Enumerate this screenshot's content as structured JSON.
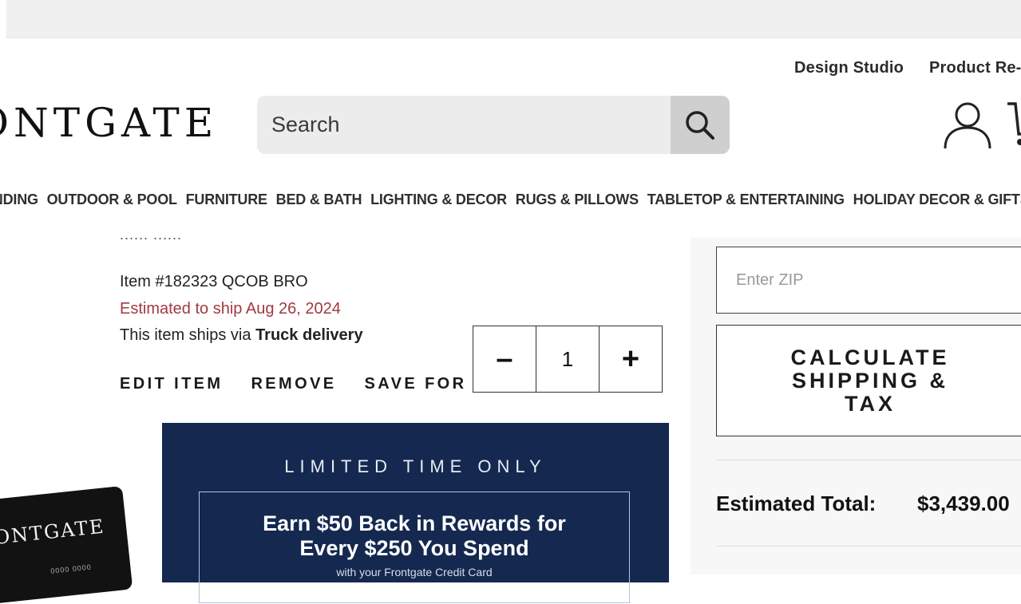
{
  "header": {
    "utility_links": [
      "Design Studio",
      "Product Re-"
    ],
    "logo_text": "ONTGATE",
    "search": {
      "placeholder": "Search"
    }
  },
  "nav": {
    "items": [
      "INDING",
      "OUTDOOR & POOL",
      "FURNITURE",
      "BED & BATH",
      "LIGHTING & DECOR",
      "RUGS & PILLOWS",
      "TABLETOP & ENTERTAINING",
      "HOLIDAY DECOR & GIFTS",
      ":"
    ]
  },
  "cart_item": {
    "cut_off_text": "......  ......",
    "item_number": "Item #182323 QCOB BRO",
    "estimated_ship": "Estimated to ship Aug 26, 2024",
    "ships_via_prefix": "This item ships via ",
    "ships_via_method": "Truck delivery",
    "actions": [
      "EDIT ITEM",
      "REMOVE",
      "SAVE FOR LATER"
    ],
    "quantity": {
      "minus": "–",
      "value": "1",
      "plus": "+"
    }
  },
  "promo": {
    "kicker": "LIMITED TIME ONLY",
    "headline_line1": "Earn $50 Back in Rewards for",
    "headline_line2": "Every $250 You Spend",
    "subtext": "with your Frontgate Credit Card",
    "card_logo": "ONTGATE",
    "card_small_text": "0000 0000"
  },
  "summary": {
    "zip_placeholder": "Enter ZIP",
    "calculate_button": "CALCULATE SHIPPING & TAX",
    "estimated_total_label": "Estimated Total:",
    "estimated_total_value": "$3,439.00"
  },
  "colors": {
    "promo_bg": "#142850",
    "ship_date": "#a13a3f",
    "search_btn_bg": "#cfcfcf"
  },
  "icons": {
    "search": "search-icon",
    "account": "account-icon",
    "cart": "cart-icon"
  }
}
